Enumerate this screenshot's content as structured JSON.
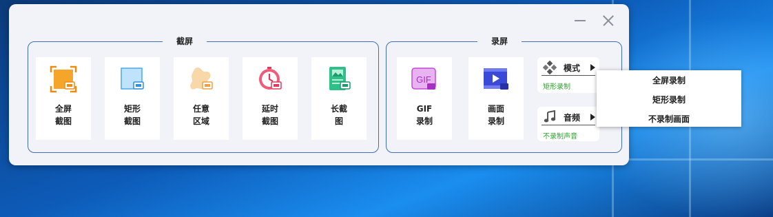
{
  "window": {
    "minimize_icon": "minimize-icon",
    "close_icon": "close-icon"
  },
  "screenshot_group": {
    "title": "截屏",
    "tiles": [
      {
        "line1": "全屏",
        "line2": "截图",
        "icon": "fullscreen-screenshot-icon"
      },
      {
        "line1": "矩形",
        "line2": "截图",
        "icon": "rectangle-screenshot-icon"
      },
      {
        "line1": "任意",
        "line2": "区域",
        "icon": "freeform-region-icon"
      },
      {
        "line1": "延时",
        "line2": "截图",
        "icon": "delayed-screenshot-icon"
      },
      {
        "line1": "长截",
        "line2": "图",
        "icon": "long-screenshot-icon"
      }
    ]
  },
  "record_group": {
    "title": "录屏",
    "tiles": [
      {
        "line1": "GIF",
        "line2": "录制",
        "icon": "gif-record-icon",
        "icon_text": "GIF"
      },
      {
        "line1": "画面",
        "line2": "录制",
        "icon": "screen-record-icon"
      }
    ],
    "mode": {
      "label": "模式",
      "value": "矩形录制",
      "icon": "mode-diamond-icon"
    },
    "audio": {
      "label": "音频",
      "value": "不录制声音",
      "icon": "music-note-icon"
    }
  },
  "mode_menu": {
    "items": [
      "全屏录制",
      "矩形录制",
      "不录制画面"
    ]
  },
  "colors": {
    "accent_border": "#3f6fb3",
    "status_green": "#2aa52a",
    "panel_bg": "#f1f3f8"
  }
}
